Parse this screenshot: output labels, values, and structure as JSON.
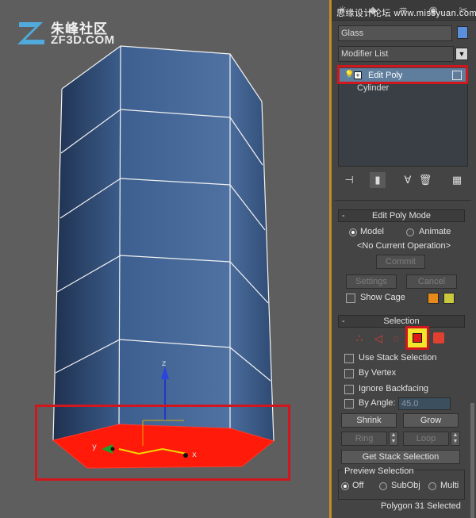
{
  "watermark": {
    "logo_cn": "朱峰社区",
    "logo_en": "ZF3D.COM",
    "panel_text": "思缘设计论坛 www.missyuan.com"
  },
  "panel": {
    "object_name": "Glass",
    "object_color": "#5b8fd9",
    "modifier_list": "Modifier List",
    "stack": [
      {
        "label": "Edit Poly",
        "selected": true
      },
      {
        "label": "Cylinder",
        "selected": false
      }
    ]
  },
  "edit_poly_mode": {
    "title": "Edit Poly Mode",
    "mode_model": "Model",
    "mode_animate": "Animate",
    "current_op": "<No Current Operation>",
    "commit": "Commit",
    "settings": "Settings",
    "cancel": "Cancel",
    "show_cage": "Show Cage",
    "cage_color_1": "#e88a1a",
    "cage_color_2": "#c9c93e"
  },
  "selection": {
    "title": "Selection",
    "use_stack": "Use Stack Selection",
    "by_vertex": "By Vertex",
    "ignore_backfacing": "Ignore Backfacing",
    "by_angle": "By Angle:",
    "angle_value": "45.0",
    "shrink": "Shrink",
    "grow": "Grow",
    "ring": "Ring",
    "loop": "Loop",
    "get_stack": "Get Stack Selection",
    "preview_title": "Preview Selection",
    "preview_off": "Off",
    "preview_subobj": "SubObj",
    "preview_multi": "Multi",
    "status": "Polygon 31 Selected"
  },
  "viewport": {
    "axis_z": "z",
    "axis_y": "y",
    "axis_x": "x",
    "selected_face_color": "#ff1a0a",
    "mesh_color": "#3c5e8e"
  }
}
